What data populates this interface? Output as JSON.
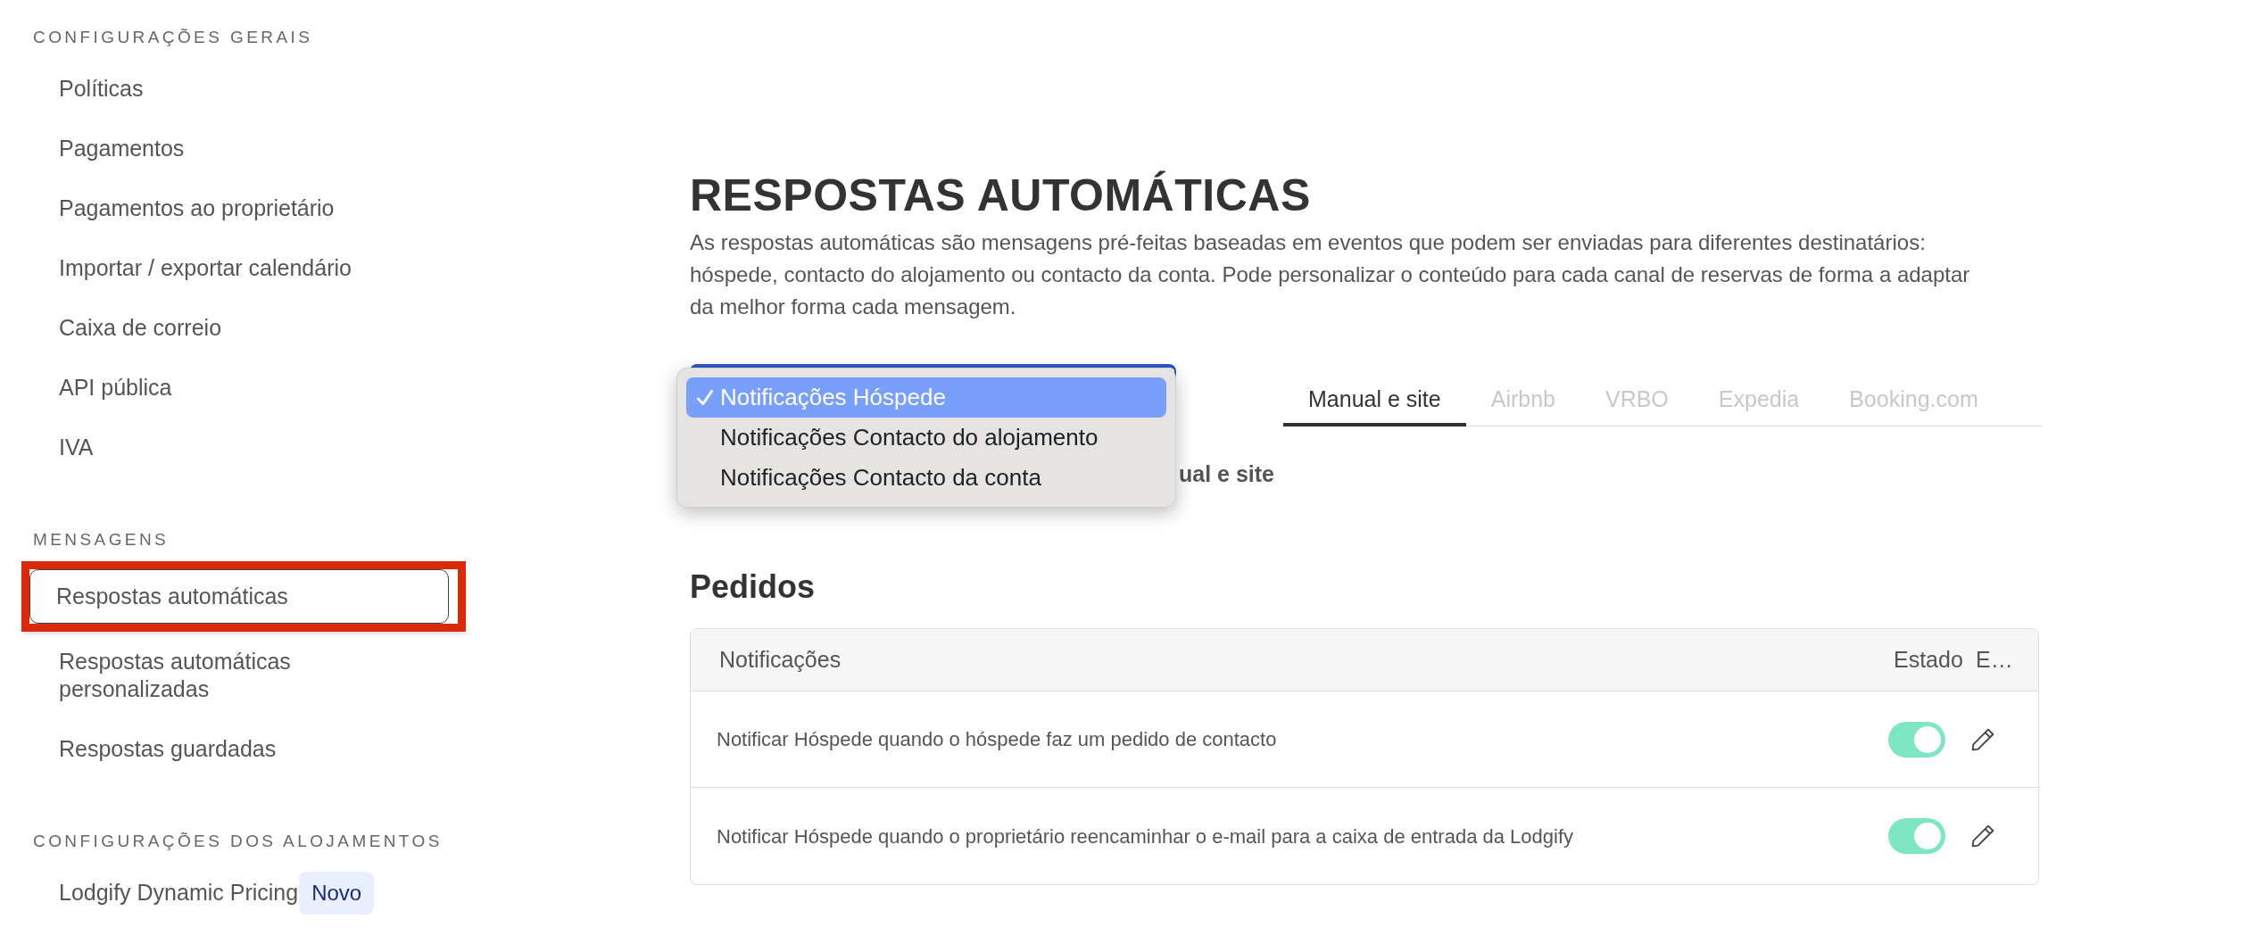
{
  "sidebar": {
    "sections": [
      {
        "heading": "CONFIGURAÇÕES GERAIS",
        "items": [
          {
            "label": "Políticas",
            "selected": false
          },
          {
            "label": "Pagamentos",
            "selected": false
          },
          {
            "label": "Pagamentos ao proprietário",
            "selected": false
          },
          {
            "label": "Importar / exportar calendário",
            "selected": false
          },
          {
            "label": "Caixa de correio",
            "selected": false
          },
          {
            "label": "API pública",
            "selected": false
          },
          {
            "label": "IVA",
            "selected": false
          }
        ]
      },
      {
        "heading": "MENSAGENS",
        "items": [
          {
            "label": "Respostas automáticas",
            "selected": true
          },
          {
            "label": "Respostas automáticas personalizadas",
            "selected": false
          },
          {
            "label": "Respostas guardadas",
            "selected": false
          }
        ]
      },
      {
        "heading": "CONFIGURAÇÕES DOS ALOJAMENTOS",
        "items": [
          {
            "label": "Lodgify Dynamic Pricing",
            "selected": false,
            "badge": "Novo"
          }
        ]
      }
    ]
  },
  "page": {
    "title": "RESPOSTAS AUTOMÁTICAS",
    "description": "As respostas automáticas são mensagens pré-feitas baseadas em eventos que podem ser enviadas para diferentes destinatários: hóspede, contacto do alojamento ou contacto da conta. Pode personalizar o conteúdo para cada canal de reservas de forma a adaptar da melhor forma cada mensagem."
  },
  "dropdown": {
    "options": [
      {
        "label": "Notificações Hóspede",
        "selected": true
      },
      {
        "label": "Notificações Contacto do alojamento",
        "selected": false
      },
      {
        "label": "Notificações Contacto da conta",
        "selected": false
      }
    ]
  },
  "tabs": [
    {
      "label": "Manual e site",
      "selected": true
    },
    {
      "label": "Airbnb",
      "selected": false
    },
    {
      "label": "VRBO",
      "selected": false
    },
    {
      "label": "Expedia",
      "selected": false
    },
    {
      "label": "Booking.com",
      "selected": false
    }
  ],
  "channel_note": "ual e site",
  "section": {
    "title": "Pedidos",
    "table": {
      "columns": [
        "Notificações",
        "Estado",
        "E…"
      ],
      "rows": [
        {
          "text": "Notificar Hóspede quando o hóspede faz um pedido de contacto",
          "on": true
        },
        {
          "text": "Notificar Hóspede quando o proprietário reencaminhar o e-mail para a caixa de entrada da Lodgify",
          "on": true
        }
      ]
    }
  }
}
